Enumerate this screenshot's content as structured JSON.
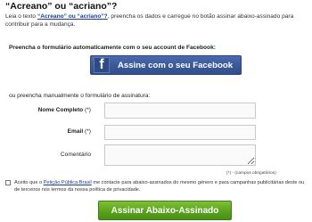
{
  "page": {
    "title": "“Acreano” ou “acriano”?",
    "intro": {
      "prefix": "Leia o texto ",
      "link": "“Acreano” ou “acriano”?",
      "suffix": ", preencha os dados e carregue no botão assinar abaixo-assinado para contribuir para a mudança."
    }
  },
  "facebook": {
    "label": "Preencha o formulário automaticamente com o seu account de Facebook:",
    "logo": "f",
    "button_label": "Assine com o seu Facebook",
    "color": "#3b5998"
  },
  "form": {
    "manual_label": "ou preencha manualmente o formulário de assinatura:",
    "fields": {
      "nome": {
        "label": "Nome Completo",
        "required_mark": "(*)",
        "value": ""
      },
      "email": {
        "label": "Email",
        "required_mark": "(*)",
        "value": ""
      },
      "comentario": {
        "label": "Comentário",
        "value": ""
      }
    },
    "required_note": "(*) - (campos obrigatórios)",
    "consent": {
      "checked": false,
      "text_prefix": "Aceito que o ",
      "link": "Petição Pública Brasil",
      "text_suffix": " me contacte para abaixo-assinados do mesmo género e para campanhas publicitárias deste ou de terceiros nos termos da nossa política de privacidade."
    },
    "submit_label": "Assinar Abaixo-Assinado",
    "submit_color": "#5ba21e"
  }
}
